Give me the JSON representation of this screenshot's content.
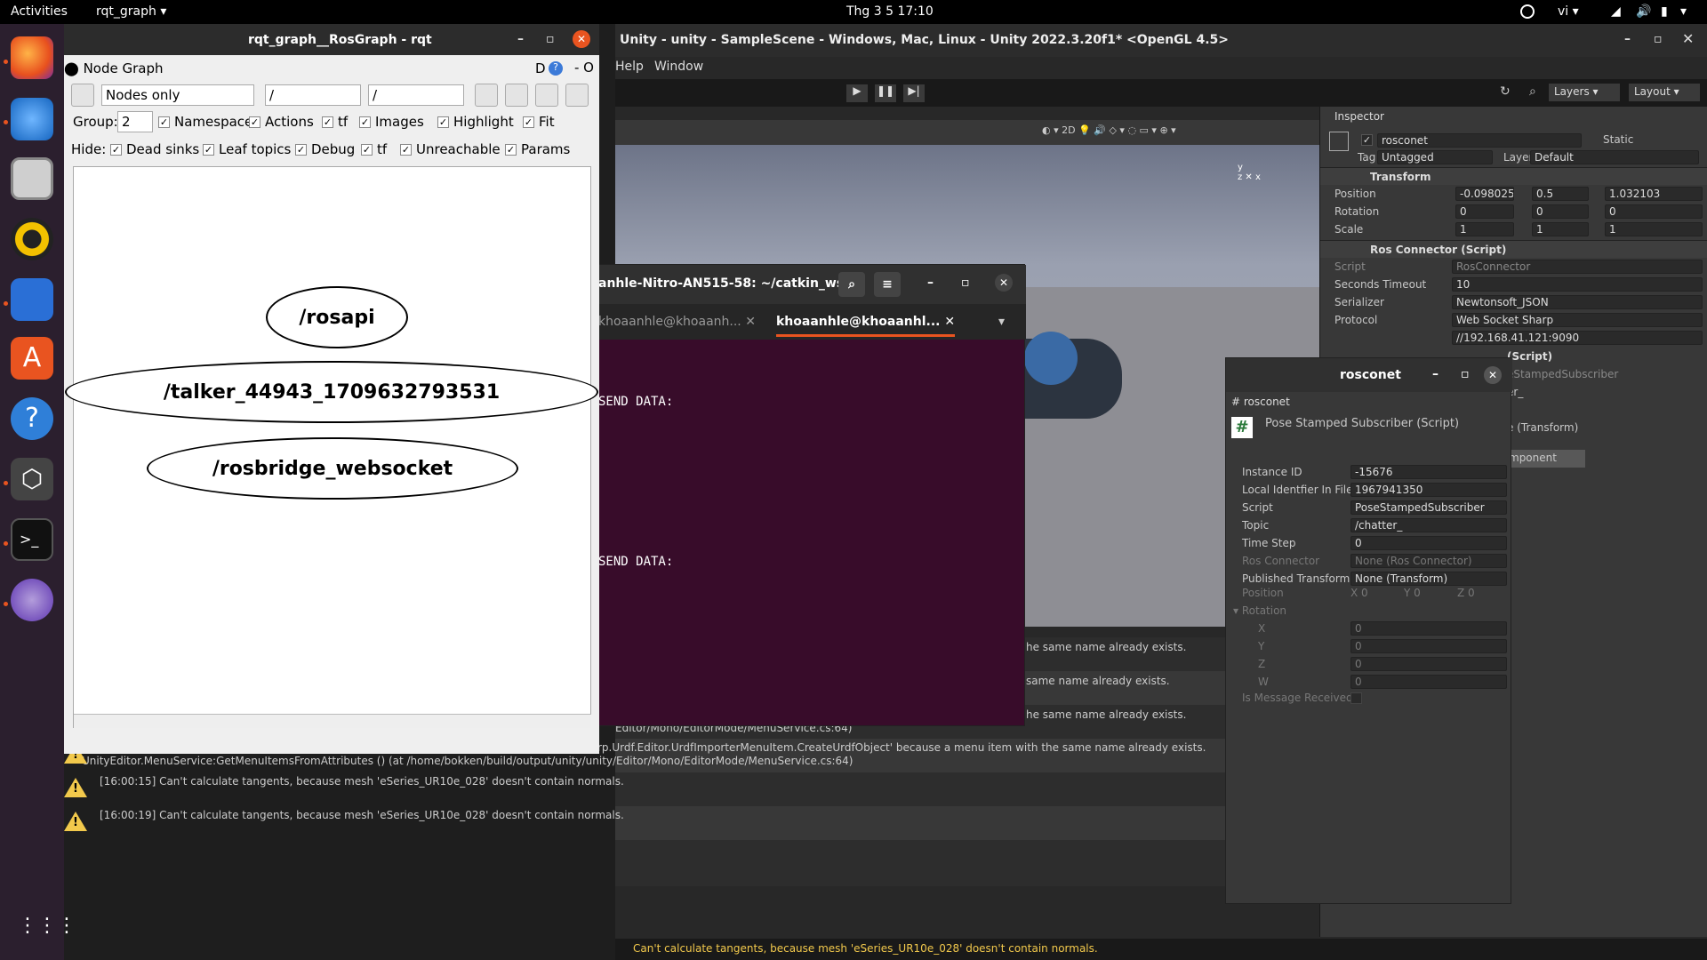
{
  "topbar": {
    "activities": "Activities",
    "app": "rqt_graph ▾",
    "clock": "Thg 3 5  17:10",
    "lang": "vi ▾"
  },
  "unity": {
    "title": "Unity - unity - SampleScene - Windows, Mac, Linux - Unity 2022.3.20f1* <OpenGL 4.5>",
    "menu": [
      "Help",
      "Window"
    ],
    "layers": "Layers",
    "layout": "Layout",
    "inspector_tab": "Inspector",
    "object_name": "rosconet",
    "static": "Static",
    "tag_label": "Tag",
    "tag_value": "Untagged",
    "layer_label": "Layer",
    "layer_value": "Default",
    "transform": {
      "title": "Transform",
      "position": {
        "label": "Position",
        "x": "-0.098025",
        "y": "0.5",
        "z": "1.032103"
      },
      "rotation": {
        "label": "Rotation",
        "x": "0",
        "y": "0",
        "z": "0"
      },
      "scale": {
        "label": "Scale",
        "x": "1",
        "y": "1",
        "z": "1"
      }
    },
    "ros_connector": {
      "title": "Ros Connector (Script)",
      "script_label": "Script",
      "script_value": "RosConnector",
      "timeout_label": "Seconds Timeout",
      "timeout_value": "10",
      "serializer_label": "Serializer",
      "serializer_value": "Newtonsoft_JSON",
      "protocol_label": "Protocol",
      "protocol_value": "Web Socket Sharp",
      "url_value": "//192.168.41.121:9090"
    },
    "partial": {
      "script": "(Script)",
      "pss": "eStampedSubscriber",
      "er": "er_",
      "transform": "e (Transform)",
      "component": "mponent"
    },
    "console": [
      {
        "text1": "he same name already exists."
      },
      {
        "text1": "same name already exists."
      },
      {
        "text1": "he same name already exists.",
        "text0": "Editor/Mono/EditorMode/MenuService.cs:64)"
      },
      {
        "text0": "rp.Urdf.Editor.UrdfImporterMenuItem.CreateUrdfObject' because a menu item with the same name already exists.",
        "text1": "UnityEditor.MenuService:GetMenuItemsFromAttributes () (at /home/bokken/build/output/unity/unity/Editor/Mono/EditorMode/MenuService.cs:64)"
      },
      {
        "text0": "[16:00:15] Can't calculate tangents, because mesh 'eSeries_UR10e_028' doesn't contain normals."
      },
      {
        "text0": "[16:00:19] Can't calculate tangents, because mesh 'eSeries_UR10e_028' doesn't contain normals."
      }
    ],
    "status": "Can't calculate tangents, because mesh 'eSeries_UR10e_028' doesn't contain normals."
  },
  "terminal": {
    "title": "anhle-Nitro-AN515-58: ~/catkin_ws",
    "tab1": "khoaanhle@khoaanh...",
    "tab2": "khoaanhle@khoaanhl...",
    "line1": "SEND DATA:",
    "line2": "SEND DATA:"
  },
  "rosconet": {
    "title": "rosconet",
    "tab": "rosconet",
    "component": "Pose Stamped Subscriber (Script)",
    "fields": [
      {
        "label": "Instance ID",
        "value": "-15676"
      },
      {
        "label": "Local Identfier In File",
        "value": "1967941350"
      },
      {
        "label": "Script",
        "value": "PoseStampedSubscriber"
      },
      {
        "label": "Topic",
        "value": "/chatter_"
      },
      {
        "label": "Time Step",
        "value": "0"
      },
      {
        "label": "Ros Connector",
        "value": "None (Ros Connector)"
      },
      {
        "label": "Published Transform",
        "value": "None (Transform)"
      }
    ],
    "position_label": "Position",
    "px": "0",
    "py": "0",
    "pz": "0",
    "rotation_label": "Rotation",
    "rx": "0",
    "ry": "0",
    "rz": "0",
    "rw": "0",
    "rxl": "X",
    "ryl": "Y",
    "rzl": "Z",
    "rwl": "W",
    "received": "Is Message Received"
  },
  "rqt": {
    "title": "rqt_graph__RosGraph - rqt",
    "plugin": "Node Graph",
    "dbtn": "D",
    "mode": "Nodes only",
    "filter1": "/",
    "filter2": "/",
    "group_label": "Group:",
    "group_value": "2",
    "row1": [
      "Namespaces",
      "Actions",
      "tf",
      "Images",
      "Highlight",
      "Fit"
    ],
    "hide_label": "Hide:",
    "row2": [
      "Dead sinks",
      "Leaf topics",
      "Debug",
      "tf",
      "Unreachable",
      "Params"
    ],
    "nodes": [
      "/rosapi",
      "/talker_44943_1709632793531",
      "/rosbridge_websocket"
    ]
  }
}
